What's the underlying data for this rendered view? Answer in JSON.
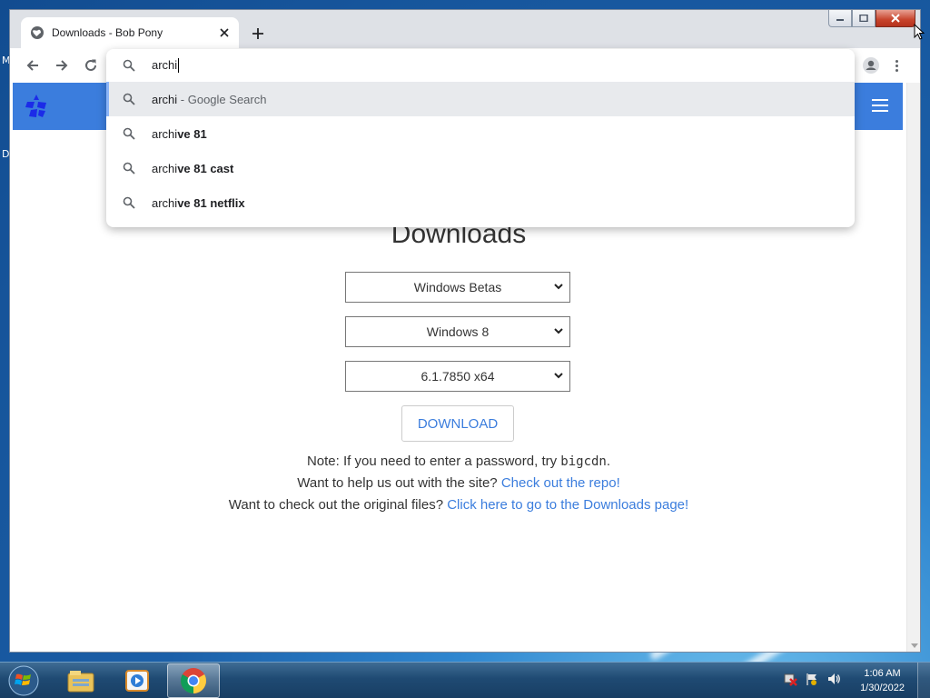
{
  "desktop": {
    "edge_letter_1": "M",
    "edge_letter_2": "D"
  },
  "browser": {
    "tab_title": "Downloads - Bob Pony",
    "omnibox": {
      "typed": "archi",
      "suggestions": [
        {
          "prefix": "archi",
          "rest": " - Google Search",
          "style": "search"
        },
        {
          "prefix": "archi",
          "rest": "ve 81",
          "style": "bold"
        },
        {
          "prefix": "archi",
          "rest": "ve 81 cast",
          "style": "bold"
        },
        {
          "prefix": "archi",
          "rest": "ve 81 netflix",
          "style": "bold"
        }
      ]
    }
  },
  "page": {
    "title": "Downloads",
    "select_category": "Windows Betas",
    "select_version": "Windows 8",
    "select_build": "6.1.7850 x64",
    "download_label": "DOWNLOAD",
    "note_prefix": "Note: If you need to enter a password, try ",
    "note_code": "bigcdn",
    "note_suffix": ".",
    "help_prefix": "Want to help us out with the site? ",
    "help_link": "Check out the repo!",
    "orig_prefix": "Want to check out the original files? ",
    "orig_link": "Click here to go to the Downloads page!"
  },
  "taskbar": {
    "time": "1:06 AM",
    "date": "1/30/2022"
  },
  "colors": {
    "accent": "#3b7ddd",
    "header": "#3b7ddd"
  },
  "icons": [
    "globe-icon",
    "close-icon",
    "plus-icon",
    "back-icon",
    "forward-icon",
    "reload-icon",
    "search-icon",
    "profile-icon",
    "menu-icon",
    "hamburger-icon",
    "start-orb-icon",
    "explorer-icon",
    "media-player-icon",
    "chrome-icon"
  ]
}
